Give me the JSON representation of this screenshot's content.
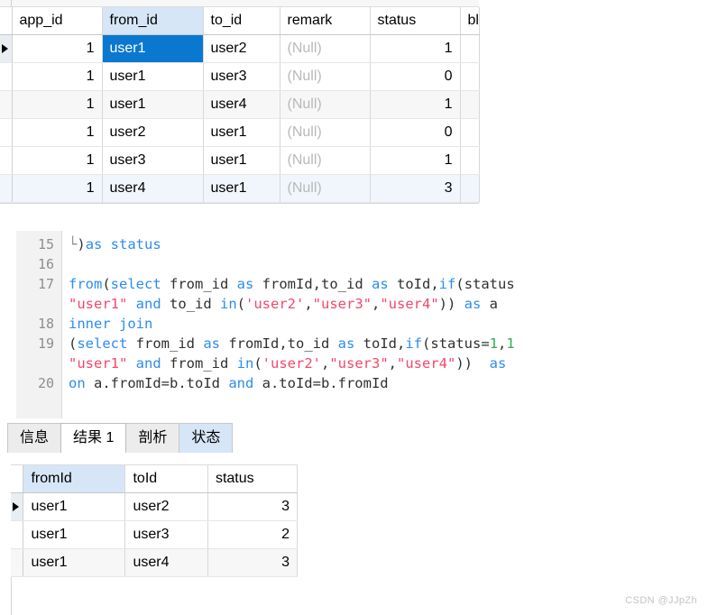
{
  "top_grid": {
    "columns": [
      "app_id",
      "from_id",
      "to_id",
      "remark",
      "status",
      "bla"
    ],
    "selected_column": "from_id",
    "rows": [
      {
        "app_id": "1",
        "from_id": "user1",
        "to_id": "user2",
        "remark": "(Null)",
        "status": "1",
        "bla": ""
      },
      {
        "app_id": "1",
        "from_id": "user1",
        "to_id": "user3",
        "remark": "(Null)",
        "status": "0",
        "bla": ""
      },
      {
        "app_id": "1",
        "from_id": "user1",
        "to_id": "user4",
        "remark": "(Null)",
        "status": "1",
        "bla": ""
      },
      {
        "app_id": "1",
        "from_id": "user2",
        "to_id": "user1",
        "remark": "(Null)",
        "status": "0",
        "bla": ""
      },
      {
        "app_id": "1",
        "from_id": "user3",
        "to_id": "user1",
        "remark": "(Null)",
        "status": "1",
        "bla": ""
      },
      {
        "app_id": "1",
        "from_id": "user4",
        "to_id": "user1",
        "remark": "(Null)",
        "status": "3",
        "bla": ""
      }
    ],
    "current_row_index": 0,
    "selected_cell": {
      "row": 0,
      "column": "from_id"
    },
    "selection_color": "#0b78d0",
    "header_select_color": "#d6e6f7"
  },
  "editor": {
    "line_numbers": [
      "15",
      "16",
      "17",
      "18",
      "19",
      "20"
    ],
    "fold_marker": "└",
    "lines": [
      {
        "number": "15",
        "text": ")as status",
        "wrap": ""
      },
      {
        "number": "16",
        "text": "",
        "wrap": ""
      },
      {
        "number": "17",
        "text": "from(select from_id as fromId,to_id as toId,if(status",
        "wrap": "\"user1\" and to_id in('user2',\"user3\",\"user4\")) as a"
      },
      {
        "number": "18",
        "text": "inner join",
        "wrap": ""
      },
      {
        "number": "19",
        "text": "(select from_id as fromId,to_id as toId,if(status=1,1",
        "wrap": "\"user1\" and from_id in('user2',\"user3\",\"user4\"))  as"
      },
      {
        "number": "20",
        "text": "on a.fromId=b.toId and a.toId=b.fromId",
        "wrap": ""
      }
    ],
    "colors": {
      "keyword": "#2d8cf0",
      "string": "#f4476b",
      "number": "#2bb24c",
      "identifier": "#303030",
      "gutter_text": "#8e8e8e",
      "gutter_bg": "#f2f2f2"
    }
  },
  "tabs": [
    {
      "label": "信息",
      "state": "inactive"
    },
    {
      "label": "结果 1",
      "state": "active"
    },
    {
      "label": "剖析",
      "state": "inactive"
    },
    {
      "label": "状态",
      "state": "tinted"
    }
  ],
  "result_grid": {
    "columns": [
      "fromId",
      "toId",
      "status"
    ],
    "selected_column": "fromId",
    "rows": [
      {
        "fromId": "user1",
        "toId": "user2",
        "status": "3"
      },
      {
        "fromId": "user1",
        "toId": "user3",
        "status": "2"
      },
      {
        "fromId": "user1",
        "toId": "user4",
        "status": "3"
      }
    ],
    "current_row_index": 0
  },
  "watermark": {
    "text": "CSDN @JJpZh"
  }
}
